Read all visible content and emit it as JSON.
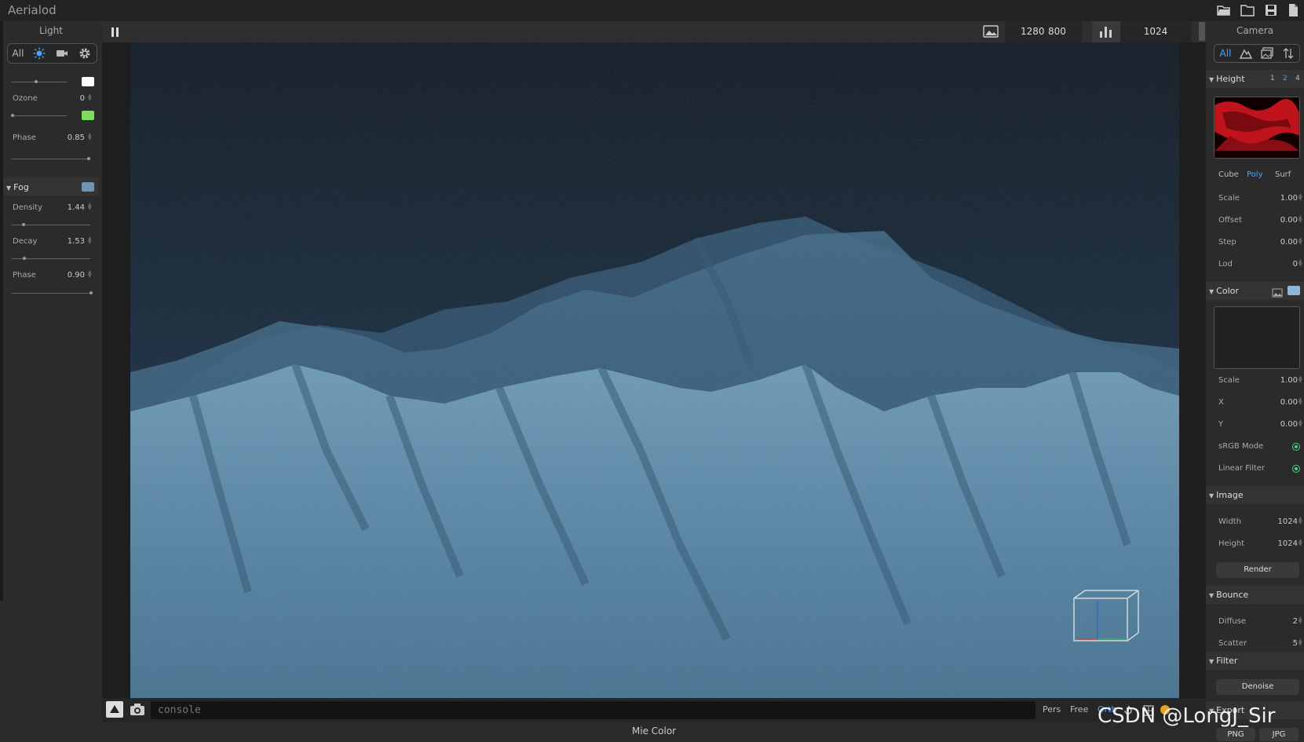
{
  "app": {
    "title": "Aerialod"
  },
  "left_panel": {
    "header": "Light",
    "segments": [
      "All",
      "sun-icon",
      "video-camera-icon",
      "gear-icon"
    ],
    "rows": [
      {
        "label": "Ozone",
        "value": "0"
      },
      {
        "label": "Phase",
        "value": "0.85"
      }
    ],
    "light_color": "#ffffff",
    "ozone_color": "#7ee05a",
    "fog": {
      "title": "Fog",
      "color": "#7393b3",
      "rows": [
        {
          "label": "Density",
          "value": "1.44"
        },
        {
          "label": "Decay",
          "value": "1.53"
        },
        {
          "label": "Phase",
          "value": "0.90"
        }
      ]
    }
  },
  "toolbar": {
    "resolution_w": "1280",
    "resolution_h": "800",
    "samples": "1024"
  },
  "bottom": {
    "console_placeholder": "console",
    "modes": [
      "Pers",
      "Free",
      "Orth"
    ],
    "status": "Mie Color"
  },
  "right_panel": {
    "header": "Camera",
    "seg_all": "All",
    "height": {
      "title": "Height",
      "lod_options": [
        "1",
        "2",
        "4"
      ],
      "lod_selected": "2",
      "modes": [
        "Cube",
        "Poly",
        "Surf"
      ],
      "mode_selected": "Poly",
      "rows": [
        {
          "label": "Scale",
          "value": "1.00"
        },
        {
          "label": "Offset",
          "value": "0.00"
        },
        {
          "label": "Step",
          "value": "0.00"
        },
        {
          "label": "Lod",
          "value": "0"
        }
      ]
    },
    "color": {
      "title": "Color",
      "swatch": "#8fb8d8",
      "rows": [
        {
          "label": "Scale",
          "value": "1.00"
        },
        {
          "label": "X",
          "value": "0.00"
        },
        {
          "label": "Y",
          "value": "0.00"
        }
      ],
      "srgb_label": "sRGB Mode",
      "linear_label": "Linear Filter"
    },
    "image": {
      "title": "Image",
      "rows": [
        {
          "label": "Width",
          "value": "1024"
        },
        {
          "label": "Height",
          "value": "1024"
        }
      ],
      "render_label": "Render"
    },
    "bounce": {
      "title": "Bounce",
      "rows": [
        {
          "label": "Diffuse",
          "value": "2"
        },
        {
          "label": "Scatter",
          "value": "5"
        }
      ]
    },
    "filter": {
      "title": "Filter",
      "denoise_label": "Denoise"
    },
    "export": {
      "title": "Export",
      "formats": [
        "PNG",
        "JPG"
      ]
    }
  },
  "watermark": "CSDN @LongJ_Sir"
}
